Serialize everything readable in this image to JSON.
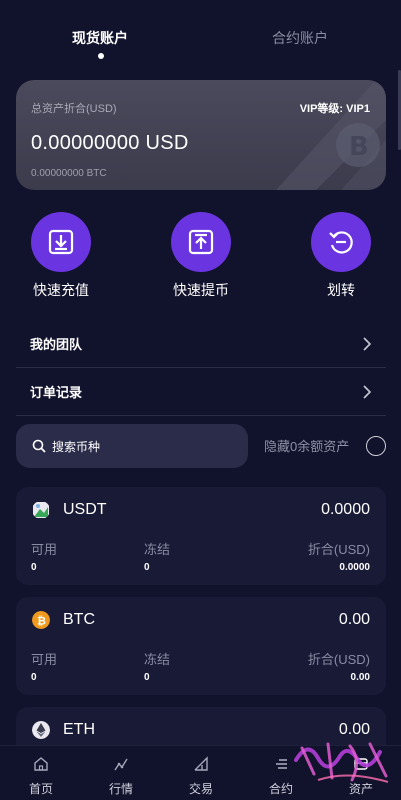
{
  "tabs": {
    "spot": "现货账户",
    "contract": "合约账户"
  },
  "summary": {
    "label": "总资产折合(USD)",
    "vip": "VIP等级: VIP1",
    "amount": "0.00000000 USD",
    "btc": "0.00000000 BTC"
  },
  "actions": [
    {
      "label": "快速充值",
      "icon": "deposit-icon"
    },
    {
      "label": "快速提币",
      "icon": "withdraw-icon"
    },
    {
      "label": "划转",
      "icon": "transfer-icon"
    }
  ],
  "menu": [
    {
      "label": "我的团队"
    },
    {
      "label": "订单记录"
    }
  ],
  "search": {
    "placeholder": "搜索币种"
  },
  "hide_zero": "隐藏0余额资产",
  "columns": {
    "available": "可用",
    "frozen": "冻结",
    "equivalent": "折合(USD)"
  },
  "assets": [
    {
      "name": "USDT",
      "value": "0.0000",
      "available": "0",
      "frozen": "0",
      "equivalent": "0.0000"
    },
    {
      "name": "BTC",
      "value": "0.00",
      "available": "0",
      "frozen": "0",
      "equivalent": "0.00"
    },
    {
      "name": "ETH",
      "value": "0.00"
    }
  ],
  "nav": [
    {
      "label": "首页",
      "icon": "home-icon"
    },
    {
      "label": "行情",
      "icon": "market-icon"
    },
    {
      "label": "交易",
      "icon": "trade-icon"
    },
    {
      "label": "合约",
      "icon": "contract-icon"
    },
    {
      "label": "资产",
      "icon": "assets-icon"
    }
  ],
  "colors": {
    "accent": "#6a35e0",
    "background": "#11122b",
    "card": "#191a36"
  }
}
